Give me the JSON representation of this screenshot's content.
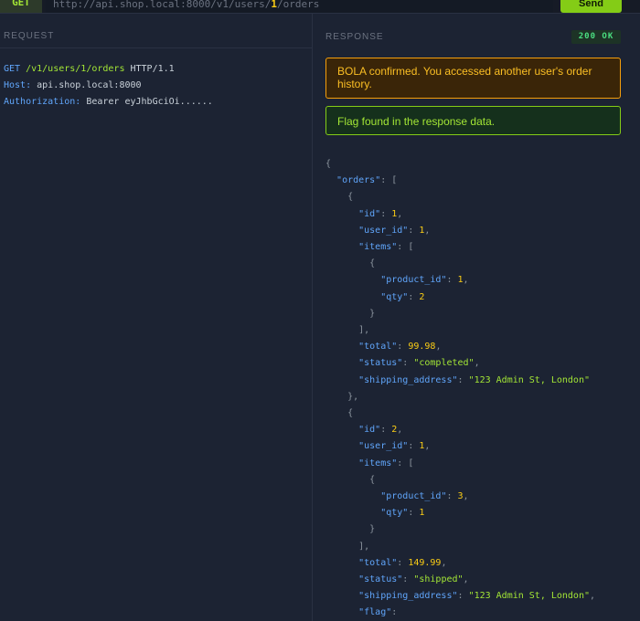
{
  "topbar": {
    "method": "GET",
    "url_prefix": "http://api.shop.local:8000/v1/users/",
    "url_user_id": "1",
    "url_suffix": "/orders",
    "send_label": "Send"
  },
  "request": {
    "label": "REQUEST",
    "method": "GET",
    "path": "/v1/users/1/orders",
    "protocol": "HTTP/1.1",
    "host_key": "Host:",
    "host_value": "api.shop.local:8000",
    "auth_key": "Authorization:",
    "auth_value": "Bearer eyJhbGciOi......"
  },
  "response": {
    "label": "RESPONSE",
    "status": "200 OK",
    "alert_warning": "BOLA confirmed. You accessed another user's order history.",
    "alert_success": "Flag found in the response data.",
    "json": {
      "orders_key": "\"orders\"",
      "orders": [
        {
          "id": "1",
          "user_id": "1",
          "items": [
            {
              "product_id": "1",
              "qty": "2"
            }
          ],
          "total": "99.98",
          "status": "\"completed\"",
          "shipping_address": "\"123 Admin St, London\""
        },
        {
          "id": "2",
          "user_id": "1",
          "items": [
            {
              "product_id": "3",
              "qty": "1"
            }
          ],
          "total": "149.99",
          "status": "\"shipped\"",
          "shipping_address": "\"123 Admin St, London\""
        }
      ],
      "keys": {
        "id": "\"id\"",
        "user_id": "\"user_id\"",
        "items": "\"items\"",
        "product_id": "\"product_id\"",
        "qty": "\"qty\"",
        "total": "\"total\"",
        "status": "\"status\"",
        "shipping_address": "\"shipping_address\"",
        "flag": "\"flag\""
      }
    }
  }
}
